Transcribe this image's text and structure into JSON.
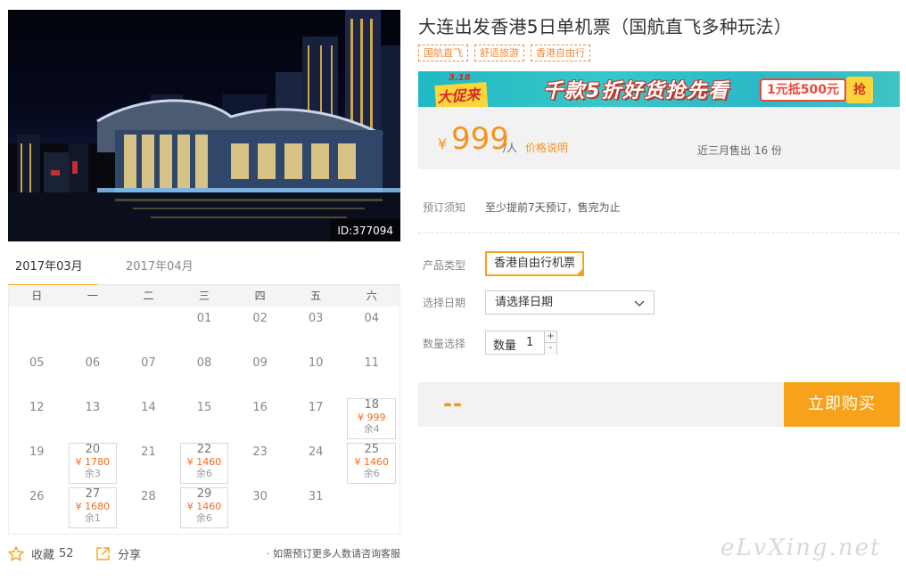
{
  "photo": {
    "id_label": "ID:377094"
  },
  "calendar": {
    "tabs": [
      {
        "label": "2017年03月",
        "active": true
      },
      {
        "label": "2017年04月",
        "active": false
      }
    ],
    "weekdays": [
      "日",
      "一",
      "二",
      "三",
      "四",
      "五",
      "六"
    ],
    "weeks": [
      [
        {
          "d": ""
        },
        {
          "d": ""
        },
        {
          "d": ""
        },
        {
          "d": "01"
        },
        {
          "d": "02"
        },
        {
          "d": "03"
        },
        {
          "d": "04"
        }
      ],
      [
        {
          "d": "05"
        },
        {
          "d": "06"
        },
        {
          "d": "07"
        },
        {
          "d": "08"
        },
        {
          "d": "09"
        },
        {
          "d": "10"
        },
        {
          "d": "11"
        }
      ],
      [
        {
          "d": "12"
        },
        {
          "d": "13"
        },
        {
          "d": "14"
        },
        {
          "d": "15"
        },
        {
          "d": "16"
        },
        {
          "d": "17"
        },
        {
          "d": "18",
          "price": "¥ 999",
          "stock": "余4"
        }
      ],
      [
        {
          "d": "19"
        },
        {
          "d": "20",
          "price": "¥ 1780",
          "stock": "余3"
        },
        {
          "d": "21"
        },
        {
          "d": "22",
          "price": "¥ 1460",
          "stock": "余6"
        },
        {
          "d": "23"
        },
        {
          "d": "24"
        },
        {
          "d": "25",
          "price": "¥ 1460",
          "stock": "余6"
        }
      ],
      [
        {
          "d": "26"
        },
        {
          "d": "27",
          "price": "¥ 1680",
          "stock": "余1"
        },
        {
          "d": "28"
        },
        {
          "d": "29",
          "price": "¥ 1460",
          "stock": "余6"
        },
        {
          "d": "30"
        },
        {
          "d": "31"
        },
        {
          "d": ""
        }
      ]
    ]
  },
  "bottom": {
    "fav_label": "收藏",
    "fav_count": "52",
    "share_label": "分享",
    "note": "· 如需预订更多人数请咨询客服"
  },
  "product": {
    "title": "大连出发香港5日单机票（国航直飞多种玩法）",
    "tags": [
      "国航直飞",
      "舒适旅游",
      "香港自由行"
    ]
  },
  "banner": {
    "date": "3.18",
    "promo": "大促来了",
    "headline": "千款5折好货抢先看",
    "coupon": "1元抵500元",
    "grab": "抢"
  },
  "price": {
    "currency": "¥",
    "amount": "999",
    "unit": "/人",
    "explain": "价格说明",
    "sold": "近三月售出 16 份"
  },
  "booking": {
    "notice_label": "预订须知",
    "notice_value": "至少提前7天预订，售完为止",
    "type_label": "产品类型",
    "type_value": "香港自由行机票",
    "date_label": "选择日期",
    "date_placeholder": "请选择日期",
    "qty_label": "数量选择",
    "qty_inner_label": "数量",
    "qty_value": "1",
    "plus": "+",
    "minus": "-"
  },
  "buy": {
    "total": "--",
    "button": "立即购买"
  },
  "watermark": "eLvXing.net"
}
